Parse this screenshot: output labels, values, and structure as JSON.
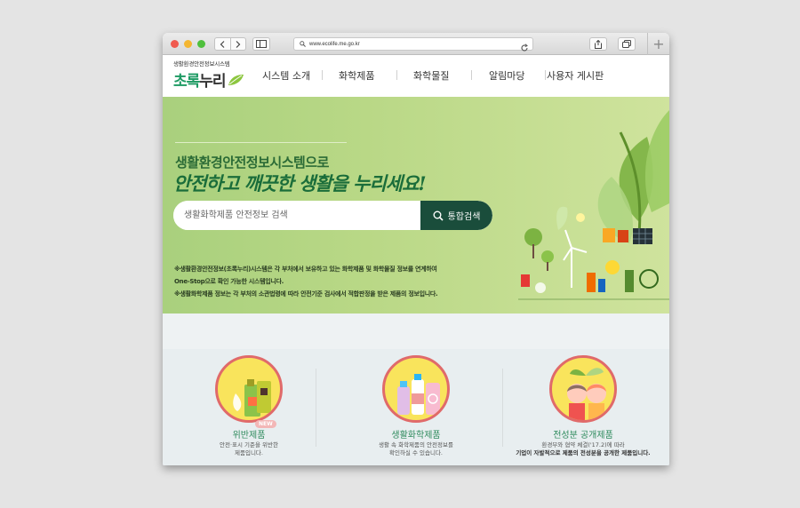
{
  "browser": {
    "url": "www.ecolife.me.go.kr",
    "colors": {
      "close": "#f05a4f",
      "minimize": "#f4b631",
      "zoom": "#4fc03d"
    }
  },
  "site": {
    "logo_sub": "생활환경안전정보시스템",
    "logo_main_a": "초록",
    "logo_main_b": "누리",
    "brand_color": "#1d9a63",
    "nav": [
      "시스템 소개",
      "화학제품",
      "화학물질",
      "알림마당",
      "사용자 게시판"
    ]
  },
  "hero": {
    "title_line1": "생활환경안전정보시스템으로",
    "title_line2": "안전하고 깨끗한 생활을 누리세요!",
    "search_placeholder": "생활화학제품 안전정보 검색",
    "search_button": "통합검색",
    "notes": [
      "※생활환경안전정보(초록누리)시스템은 각 부처에서 보유하고 있는 화학제품 및 화학물질 정보를 연계하여",
      "One-Stop으로 확인 가능한 시스템입니다.",
      "※생활화학제품 정보는 각 부처의 소관법령에 따라 안전기준 검사에서 적합판정을 받은 제품의 정보입니다."
    ]
  },
  "cards": [
    {
      "title": "위반제품",
      "badge": "NEW",
      "desc_1": "안전·표시 기준을 위반한",
      "desc_2": "제품입니다."
    },
    {
      "title": "생활화학제품",
      "desc_1": "생활 속 화학제품의 안전정보를",
      "desc_2": "확인하실 수 있습니다."
    },
    {
      "title": "전성분 공개제품",
      "desc_1": "환경부와 협약 체결('17.2)에 따라",
      "desc_2": "기업이 자발적으로 제품의 전성분을 공개한 제품입니다."
    }
  ]
}
